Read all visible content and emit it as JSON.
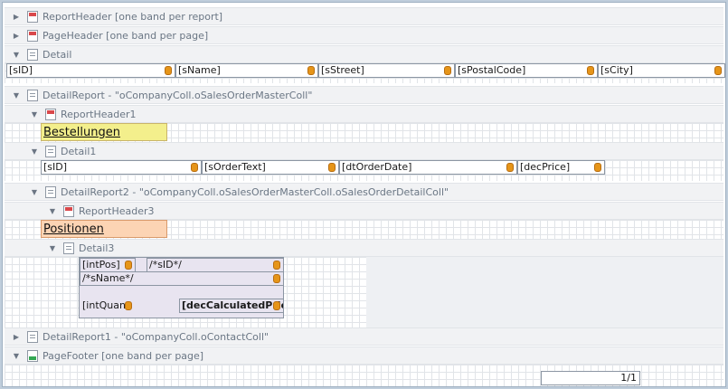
{
  "bands": {
    "report_header": "ReportHeader [one band per report]",
    "page_header": "PageHeader [one band per page]",
    "detail": "Detail",
    "detail_report": "DetailReport - \"oCompanyColl.oSalesOrderMasterColl\"",
    "report_header1": "ReportHeader1",
    "detail1": "Detail1",
    "detail_report2": "DetailReport2 - \"oCompanyColl.oSalesOrderMasterColl.oSalesOrderDetailColl\"",
    "report_header3": "ReportHeader3",
    "detail3": "Detail3",
    "detail_report1": "DetailReport1 - \"oCompanyColl.oContactColl\"",
    "page_footer": "PageFooter [one band per page]"
  },
  "detail_fields": [
    "[sID]",
    "[sName]",
    "[sStreet]",
    "[sPostalCode]",
    "[sCity]"
  ],
  "bestellungen": "Bestellungen",
  "detail1_fields": [
    "[sID]",
    "[sOrderText]",
    "[dtOrderDate]",
    "[decPrice]"
  ],
  "positionen": "Positionen",
  "detail3_fields": {
    "int_pos": "[intPos]",
    "s_id": "/*sID*/",
    "s_name": "/*sName*/",
    "int_quant": "[intQuant",
    "dec_calc_price": "[decCalculatedPrice"
  },
  "page_number": "1/1",
  "colors": {
    "bestellungen_bg": "#f3ef8c",
    "positionen_bg": "#fcd4b4",
    "db_icon": "#e69519"
  }
}
